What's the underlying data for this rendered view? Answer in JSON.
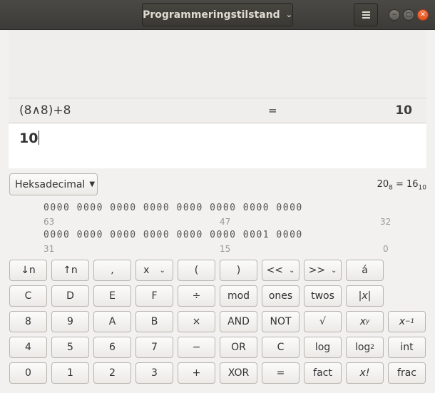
{
  "titlebar": {
    "mode": "Programmeringstilstand"
  },
  "display": {
    "history_expr": "(8∧8)+8",
    "history_eq": "=",
    "history_result": "10",
    "entry_value": "10"
  },
  "base": {
    "selected": "Heksadecimal",
    "conversion": "20",
    "conversion_base1": "8",
    "conversion_eq": " = 16",
    "conversion_base2": "10"
  },
  "bits": {
    "row1": "0000 0000 0000 0000 0000 0000 0000 0000",
    "row2": "0000 0000 0000 0000 0000 0000 0001 0000",
    "labels1": [
      "63",
      "47",
      "32"
    ],
    "labels2": [
      "31",
      "15",
      "0"
    ]
  },
  "buttons": {
    "row1": [
      "↓n",
      "↑n",
      ",",
      "x",
      "(",
      ")",
      "<<",
      ">>",
      "á"
    ],
    "row2": [
      "C",
      "D",
      "E",
      "F",
      "÷",
      "mod",
      "ones",
      "twos",
      "|x|"
    ],
    "row3": [
      "8",
      "9",
      "A",
      "B",
      "×",
      "AND",
      "NOT",
      "√",
      "x",
      "y",
      "x",
      "−1"
    ],
    "row4": [
      "4",
      "5",
      "6",
      "7",
      "−",
      "OR",
      "C",
      "log",
      "log",
      "2",
      "int"
    ],
    "row5": [
      "0",
      "1",
      "2",
      "3",
      "+",
      "XOR",
      "=",
      "fact",
      "x!",
      "frac"
    ]
  }
}
